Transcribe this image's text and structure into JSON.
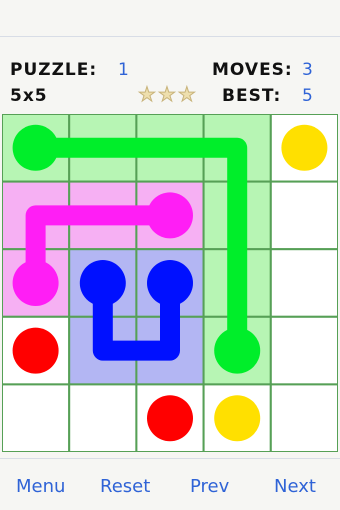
{
  "hud": {
    "puzzle_label": "PUZZLE:",
    "puzzle_value": "1",
    "moves_label": "MOVES:",
    "moves_value": "3",
    "size_label": "5x5",
    "best_label": "BEST:",
    "best_value": "5",
    "stars": 3
  },
  "board": {
    "rows": 5,
    "cols": 5,
    "colors": {
      "green": "#00ee2a",
      "green_fill": "#b7f5b4",
      "magenta": "#ff1ef5",
      "magenta_fill": "#f6b0f3",
      "blue": "#0010ff",
      "blue_fill": "#b3b6f3",
      "red": "#ff0000",
      "yellow": "#ffe000",
      "grid": "#56a056",
      "cell": "#ffffff"
    },
    "filled": [
      {
        "r": 0,
        "c": 0,
        "color": "green_fill"
      },
      {
        "r": 0,
        "c": 1,
        "color": "green_fill"
      },
      {
        "r": 0,
        "c": 2,
        "color": "green_fill"
      },
      {
        "r": 0,
        "c": 3,
        "color": "green_fill"
      },
      {
        "r": 1,
        "c": 3,
        "color": "green_fill"
      },
      {
        "r": 2,
        "c": 3,
        "color": "green_fill"
      },
      {
        "r": 3,
        "c": 3,
        "color": "green_fill"
      },
      {
        "r": 1,
        "c": 0,
        "color": "magenta_fill"
      },
      {
        "r": 1,
        "c": 1,
        "color": "magenta_fill"
      },
      {
        "r": 1,
        "c": 2,
        "color": "magenta_fill"
      },
      {
        "r": 2,
        "c": 0,
        "color": "magenta_fill"
      },
      {
        "r": 2,
        "c": 1,
        "color": "blue_fill"
      },
      {
        "r": 2,
        "c": 2,
        "color": "blue_fill"
      },
      {
        "r": 3,
        "c": 1,
        "color": "blue_fill"
      },
      {
        "r": 3,
        "c": 2,
        "color": "blue_fill"
      }
    ],
    "dots": [
      {
        "r": 0,
        "c": 0,
        "color": "green"
      },
      {
        "r": 3,
        "c": 3,
        "color": "green"
      },
      {
        "r": 1,
        "c": 2,
        "color": "magenta"
      },
      {
        "r": 2,
        "c": 0,
        "color": "magenta"
      },
      {
        "r": 2,
        "c": 1,
        "color": "blue"
      },
      {
        "r": 2,
        "c": 2,
        "color": "blue"
      },
      {
        "r": 3,
        "c": 0,
        "color": "red"
      },
      {
        "r": 4,
        "c": 2,
        "color": "red"
      },
      {
        "r": 0,
        "c": 4,
        "color": "yellow"
      },
      {
        "r": 4,
        "c": 3,
        "color": "yellow"
      }
    ],
    "paths": [
      {
        "color": "green",
        "cells": [
          [
            0,
            0
          ],
          [
            0,
            1
          ],
          [
            0,
            2
          ],
          [
            0,
            3
          ],
          [
            1,
            3
          ],
          [
            2,
            3
          ],
          [
            3,
            3
          ]
        ]
      },
      {
        "color": "magenta",
        "cells": [
          [
            1,
            2
          ],
          [
            1,
            1
          ],
          [
            1,
            0
          ],
          [
            2,
            0
          ]
        ]
      },
      {
        "color": "blue",
        "cells": [
          [
            2,
            1
          ],
          [
            3,
            1
          ],
          [
            3,
            2
          ],
          [
            2,
            2
          ]
        ]
      }
    ]
  },
  "nav": {
    "menu": "Menu",
    "reset": "Reset",
    "prev": "Prev",
    "next": "Next"
  }
}
